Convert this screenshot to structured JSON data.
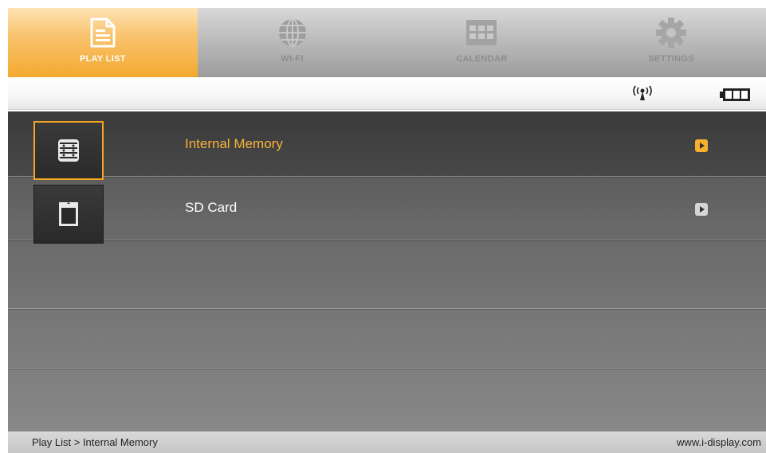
{
  "tabs": [
    {
      "label": "PLAY LIST",
      "icon": "document-icon",
      "active": true
    },
    {
      "label": "WI-FI",
      "icon": "globe-icon",
      "active": false
    },
    {
      "label": "CALENDAR",
      "icon": "calendar-icon",
      "active": false
    },
    {
      "label": "SETTINGS",
      "icon": "gear-icon",
      "active": false
    }
  ],
  "status": {
    "wifi_icon": "wifi-antenna-icon",
    "battery_icon": "battery-icon"
  },
  "list": {
    "items": [
      {
        "label": "Internal Memory",
        "icon": "internal-memory-icon",
        "selected": true
      },
      {
        "label": "SD Card",
        "icon": "sd-card-icon",
        "selected": false
      }
    ]
  },
  "footer": {
    "breadcrumb": "Play List > Internal Memory",
    "website": "www.i-display.com"
  },
  "colors": {
    "accent": "#f5a623",
    "tab_active": "#f3a92f",
    "list_background": "#686868"
  }
}
